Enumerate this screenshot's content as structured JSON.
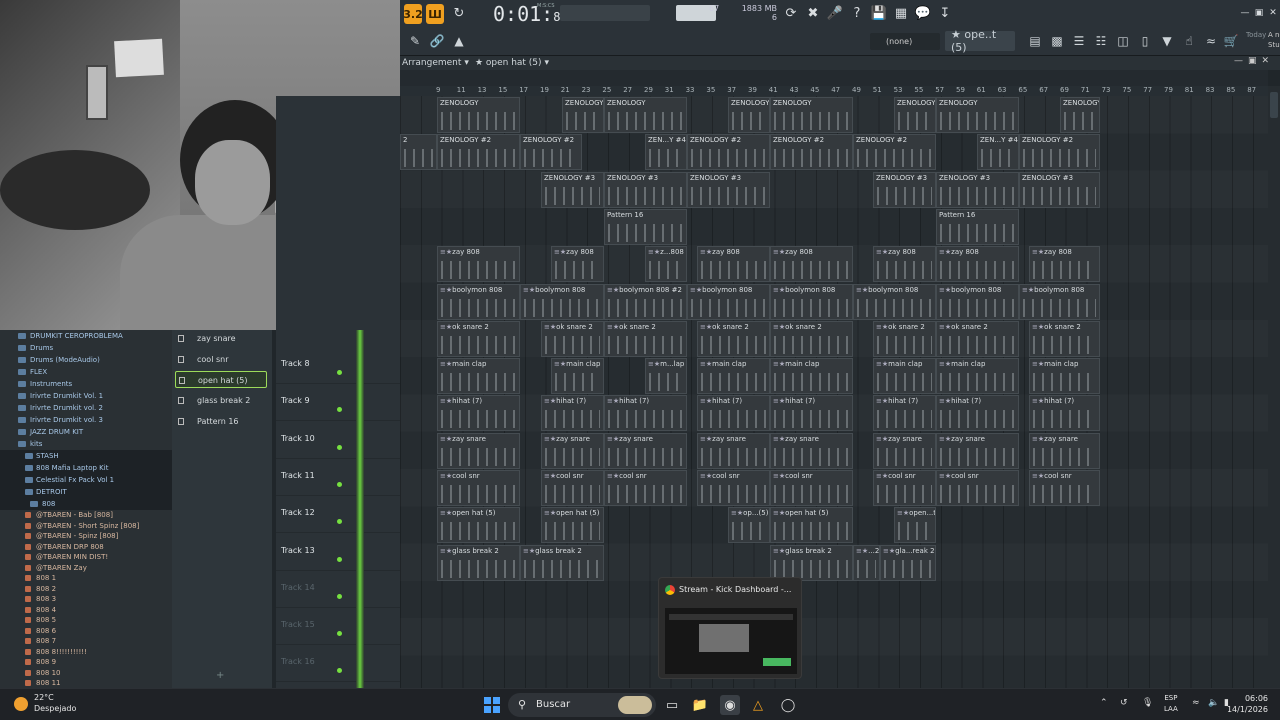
{
  "toolbar": {
    "mode_pat": "3.2",
    "mode_song": "Ш",
    "time_main": "0:01",
    "time_frac": "89",
    "time_label": "M:S:CS",
    "cpu_value": "67",
    "ram_value": "1883 MB",
    "poly_value": "6",
    "none_label": "(none)",
    "pattern_label": "★ ope..t (5)",
    "news_today": "Today",
    "news_text": "A newer version of FL Studio is available!"
  },
  "arrangement": {
    "title": "Arrangement",
    "pattern": "★ open hat (5)"
  },
  "ruler": {
    "ticks": [
      "9",
      "11",
      "13",
      "15",
      "17",
      "19",
      "21",
      "23",
      "25",
      "27",
      "29",
      "31",
      "33",
      "35",
      "37",
      "39",
      "41",
      "43",
      "45",
      "47",
      "49",
      "51",
      "53",
      "55",
      "57",
      "59",
      "61",
      "63",
      "65",
      "67",
      "69",
      "71",
      "73",
      "75",
      "77",
      "79",
      "81",
      "83",
      "85",
      "87"
    ]
  },
  "browser": {
    "items": [
      {
        "label": "DRUMKIT CEROPROBLEMA",
        "level": 0
      },
      {
        "label": "Drums",
        "level": 0
      },
      {
        "label": "Drums (ModeAudio)",
        "level": 0
      },
      {
        "label": "FLEX",
        "level": 0
      },
      {
        "label": "Instruments",
        "level": 0
      },
      {
        "label": "Irivrte Drumkit Vol. 1",
        "level": 0
      },
      {
        "label": "Irivrte Drumkit vol. 2",
        "level": 0
      },
      {
        "label": "Irivrte Drumkit vol. 3",
        "level": 0
      },
      {
        "label": "JAZZ DRUM KIT",
        "level": 0
      },
      {
        "label": "kits",
        "level": 0
      },
      {
        "label": "STASH",
        "level": 1
      },
      {
        "label": "808 Mafia Laptop Kit",
        "level": 1
      },
      {
        "label": "Celestial Fx Pack Vol 1",
        "level": 1
      },
      {
        "label": "DETROIT",
        "level": 1
      },
      {
        "label": "808",
        "level": 2
      }
    ],
    "files": [
      "@TBAREN - Bab [808]",
      "@TBAREN - Short Spinz [808]",
      "@TBAREN - Spinz [808]",
      "@TBAREN DRP 808",
      "@TBAREN MIN DIST!",
      "@TBAREN Zay",
      "808 1",
      "808 2",
      "808 3",
      "808 4",
      "808 5",
      "808 6",
      "808 7",
      "808 8!!!!!!!!!!!",
      "808 9",
      "808 10",
      "808 11"
    ]
  },
  "channels": [
    {
      "label": "zay snare",
      "active": false
    },
    {
      "label": "cool snr",
      "active": false
    },
    {
      "label": "open hat (5)",
      "active": true
    },
    {
      "label": "glass break 2",
      "active": false
    },
    {
      "label": "Pattern 16",
      "active": false
    }
  ],
  "tracks": [
    "Track 8",
    "Track 9",
    "Track 10",
    "Track 11",
    "Track 12",
    "Track 13",
    "Track 14",
    "Track 15",
    "Track 16"
  ],
  "clips": [
    {
      "label": "ZENOLOGY",
      "row": 0,
      "start": 437,
      "w": 83,
      "plain": true
    },
    {
      "label": "ZENOLOGY",
      "row": 0,
      "start": 562,
      "w": 42,
      "plain": true
    },
    {
      "label": "ZENOLOGY",
      "row": 0,
      "start": 604,
      "w": 83,
      "plain": true
    },
    {
      "label": "ZENOLOGY",
      "row": 0,
      "start": 728,
      "w": 42,
      "plain": true
    },
    {
      "label": "ZENOLOGY",
      "row": 0,
      "start": 770,
      "w": 83,
      "plain": true
    },
    {
      "label": "ZENOLOGY",
      "row": 0,
      "start": 894,
      "w": 42,
      "plain": true
    },
    {
      "label": "ZENOLOGY",
      "row": 0,
      "start": 936,
      "w": 83,
      "plain": true
    },
    {
      "label": "ZENOLOGY",
      "row": 0,
      "start": 1060,
      "w": 40,
      "plain": true
    },
    {
      "label": "2",
      "row": 1,
      "start": 400,
      "w": 37,
      "plain": true
    },
    {
      "label": "ZENOLOGY #2",
      "row": 1,
      "start": 437,
      "w": 83,
      "plain": true
    },
    {
      "label": "ZENOLOGY #2",
      "row": 1,
      "start": 520,
      "w": 62,
      "plain": true
    },
    {
      "label": "ZEN...Y #4",
      "row": 1,
      "start": 645,
      "w": 42,
      "plain": true
    },
    {
      "label": "ZENOLOGY #2",
      "row": 1,
      "start": 687,
      "w": 83,
      "plain": true
    },
    {
      "label": "ZENOLOGY #2",
      "row": 1,
      "start": 770,
      "w": 83,
      "plain": true
    },
    {
      "label": "ZENOLOGY #2",
      "row": 1,
      "start": 853,
      "w": 83,
      "plain": true
    },
    {
      "label": "ZEN...Y #4",
      "row": 1,
      "start": 977,
      "w": 42,
      "plain": true
    },
    {
      "label": "ZENOLOGY #2",
      "row": 1,
      "start": 1019,
      "w": 81,
      "plain": true
    },
    {
      "label": "ZENOLOGY #3",
      "row": 2,
      "start": 541,
      "w": 63,
      "plain": true
    },
    {
      "label": "ZENOLOGY #3",
      "row": 2,
      "start": 604,
      "w": 83,
      "plain": true
    },
    {
      "label": "ZENOLOGY #3",
      "row": 2,
      "start": 687,
      "w": 83,
      "plain": true
    },
    {
      "label": "ZENOLOGY #3",
      "row": 2,
      "start": 873,
      "w": 63,
      "plain": true
    },
    {
      "label": "ZENOLOGY #3",
      "row": 2,
      "start": 936,
      "w": 83,
      "plain": true
    },
    {
      "label": "ZENOLOGY #3",
      "row": 2,
      "start": 1019,
      "w": 81,
      "plain": true
    },
    {
      "label": "Pattern 16",
      "row": 3,
      "start": 604,
      "w": 83,
      "plain": true
    },
    {
      "label": "Pattern 16",
      "row": 3,
      "start": 936,
      "w": 83,
      "plain": true
    },
    {
      "label": "zay 808",
      "row": 4,
      "start": 437,
      "w": 83
    },
    {
      "label": "zay 808",
      "row": 4,
      "start": 551,
      "w": 53
    },
    {
      "label": "z...808",
      "row": 4,
      "start": 645,
      "w": 42
    },
    {
      "label": "zay 808",
      "row": 4,
      "start": 697,
      "w": 73
    },
    {
      "label": "zay 808",
      "row": 4,
      "start": 770,
      "w": 83
    },
    {
      "label": "zay 808",
      "row": 4,
      "start": 873,
      "w": 63
    },
    {
      "label": "zay 808",
      "row": 4,
      "start": 936,
      "w": 83
    },
    {
      "label": "zay 808",
      "row": 4,
      "start": 1029,
      "w": 71
    },
    {
      "label": "boolymon 808",
      "row": 5,
      "start": 437,
      "w": 83
    },
    {
      "label": "boolymon 808",
      "row": 5,
      "start": 520,
      "w": 84
    },
    {
      "label": "boolymon 808 #2",
      "row": 5,
      "start": 604,
      "w": 83
    },
    {
      "label": "boolymon 808",
      "row": 5,
      "start": 687,
      "w": 83
    },
    {
      "label": "boolymon 808",
      "row": 5,
      "start": 770,
      "w": 83
    },
    {
      "label": "boolymon 808",
      "row": 5,
      "start": 853,
      "w": 83
    },
    {
      "label": "boolymon 808",
      "row": 5,
      "start": 936,
      "w": 83
    },
    {
      "label": "boolymon 808",
      "row": 5,
      "start": 1019,
      "w": 81
    },
    {
      "label": "ok snare 2",
      "row": 6,
      "start": 437,
      "w": 83
    },
    {
      "label": "ok snare 2",
      "row": 6,
      "start": 541,
      "w": 63
    },
    {
      "label": "ok snare 2",
      "row": 6,
      "start": 604,
      "w": 83
    },
    {
      "label": "ok snare 2",
      "row": 6,
      "start": 697,
      "w": 73
    },
    {
      "label": "ok snare 2",
      "row": 6,
      "start": 770,
      "w": 83
    },
    {
      "label": "ok snare 2",
      "row": 6,
      "start": 873,
      "w": 63
    },
    {
      "label": "ok snare 2",
      "row": 6,
      "start": 936,
      "w": 83
    },
    {
      "label": "ok snare 2",
      "row": 6,
      "start": 1029,
      "w": 71
    },
    {
      "label": "main clap",
      "row": 7,
      "start": 437,
      "w": 83
    },
    {
      "label": "main clap",
      "row": 7,
      "start": 551,
      "w": 53
    },
    {
      "label": "m...lap",
      "row": 7,
      "start": 645,
      "w": 42
    },
    {
      "label": "main clap",
      "row": 7,
      "start": 697,
      "w": 73
    },
    {
      "label": "main clap",
      "row": 7,
      "start": 770,
      "w": 83
    },
    {
      "label": "main clap",
      "row": 7,
      "start": 873,
      "w": 63
    },
    {
      "label": "main clap",
      "row": 7,
      "start": 936,
      "w": 83
    },
    {
      "label": "main clap",
      "row": 7,
      "start": 1029,
      "w": 71
    },
    {
      "label": "hihat (7)",
      "row": 8,
      "start": 437,
      "w": 83
    },
    {
      "label": "hihat (7)",
      "row": 8,
      "start": 541,
      "w": 63
    },
    {
      "label": "hihat (7)",
      "row": 8,
      "start": 604,
      "w": 83
    },
    {
      "label": "hihat (7)",
      "row": 8,
      "start": 697,
      "w": 73
    },
    {
      "label": "hihat (7)",
      "row": 8,
      "start": 770,
      "w": 83
    },
    {
      "label": "hihat (7)",
      "row": 8,
      "start": 873,
      "w": 63
    },
    {
      "label": "hihat (7)",
      "row": 8,
      "start": 936,
      "w": 83
    },
    {
      "label": "hihat (7)",
      "row": 8,
      "start": 1029,
      "w": 71
    },
    {
      "label": "zay snare",
      "row": 9,
      "start": 437,
      "w": 83
    },
    {
      "label": "zay snare",
      "row": 9,
      "start": 541,
      "w": 63
    },
    {
      "label": "zay snare",
      "row": 9,
      "start": 604,
      "w": 83
    },
    {
      "label": "zay snare",
      "row": 9,
      "start": 697,
      "w": 73
    },
    {
      "label": "zay snare",
      "row": 9,
      "start": 770,
      "w": 83
    },
    {
      "label": "zay snare",
      "row": 9,
      "start": 873,
      "w": 63
    },
    {
      "label": "zay snare",
      "row": 9,
      "start": 936,
      "w": 83
    },
    {
      "label": "zay snare",
      "row": 9,
      "start": 1029,
      "w": 71
    },
    {
      "label": "cool snr",
      "row": 10,
      "start": 437,
      "w": 83
    },
    {
      "label": "cool snr",
      "row": 10,
      "start": 541,
      "w": 63
    },
    {
      "label": "cool snr",
      "row": 10,
      "start": 604,
      "w": 83
    },
    {
      "label": "cool snr",
      "row": 10,
      "start": 697,
      "w": 73
    },
    {
      "label": "cool snr",
      "row": 10,
      "start": 770,
      "w": 83
    },
    {
      "label": "cool snr",
      "row": 10,
      "start": 873,
      "w": 63
    },
    {
      "label": "cool snr",
      "row": 10,
      "start": 936,
      "w": 83
    },
    {
      "label": "cool snr",
      "row": 10,
      "start": 1029,
      "w": 71
    },
    {
      "label": "open hat (5)",
      "row": 11,
      "start": 437,
      "w": 83
    },
    {
      "label": "open hat (5)",
      "row": 11,
      "start": 541,
      "w": 63
    },
    {
      "label": "op...(5)",
      "row": 11,
      "start": 728,
      "w": 42
    },
    {
      "label": "open hat (5)",
      "row": 11,
      "start": 770,
      "w": 83
    },
    {
      "label": "open...t (5)",
      "row": 11,
      "start": 894,
      "w": 42
    },
    {
      "label": "glass break 2",
      "row": 12,
      "start": 437,
      "w": 83
    },
    {
      "label": "glass break 2",
      "row": 12,
      "start": 520,
      "w": 84
    },
    {
      "label": "glass break 2",
      "row": 12,
      "start": 770,
      "w": 83
    },
    {
      "label": "...2",
      "row": 12,
      "start": 853,
      "w": 27
    },
    {
      "label": "gla...reak 2",
      "row": 12,
      "start": 880,
      "w": 56
    }
  ],
  "preview": {
    "title": "Stream - Kick Dashboard -..."
  },
  "taskbar": {
    "temp": "22°C",
    "weather": "Despejado",
    "search": "Buscar",
    "lang1": "ESP",
    "lang2": "LAA",
    "time": "06:06",
    "date": "14/1/2026"
  }
}
